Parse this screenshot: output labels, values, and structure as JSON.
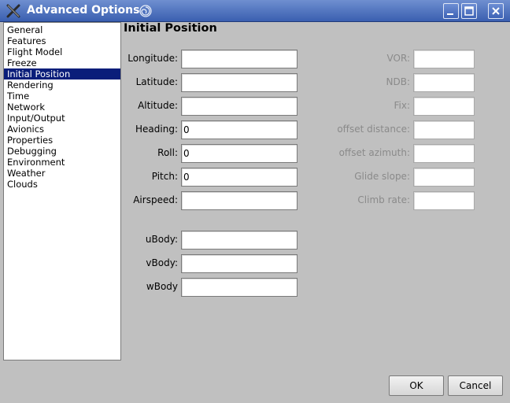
{
  "window": {
    "title": "Advanced Options"
  },
  "sidebar": {
    "items": [
      "General",
      "Features",
      "Flight Model",
      "Freeze",
      "Initial Position",
      "Rendering",
      "Time",
      "Network",
      "Input/Output",
      "Avionics",
      "Properties",
      "Debugging",
      "Environment",
      "Weather",
      "Clouds"
    ],
    "selected_index": 4
  },
  "section": {
    "title": "Initial Position"
  },
  "left_fields": [
    {
      "label": "Longitude:",
      "value": ""
    },
    {
      "label": "Latitude:",
      "value": ""
    },
    {
      "label": "Altitude:",
      "value": ""
    },
    {
      "label": "Heading:",
      "value": "0"
    },
    {
      "label": "Roll:",
      "value": "0"
    },
    {
      "label": "Pitch:",
      "value": "0"
    },
    {
      "label": "Airspeed:",
      "value": ""
    }
  ],
  "body_fields": [
    {
      "label": "uBody:",
      "value": ""
    },
    {
      "label": "vBody:",
      "value": ""
    },
    {
      "label": "wBody",
      "value": ""
    }
  ],
  "right_fields": [
    {
      "label": "VOR:",
      "value": ""
    },
    {
      "label": "NDB:",
      "value": ""
    },
    {
      "label": "Fix:",
      "value": ""
    },
    {
      "label": "offset distance:",
      "value": ""
    },
    {
      "label": "offset azimuth:",
      "value": ""
    },
    {
      "label": "Glide slope:",
      "value": ""
    },
    {
      "label": "Climb rate:",
      "value": ""
    }
  ],
  "buttons": {
    "ok": "OK",
    "cancel": "Cancel"
  }
}
